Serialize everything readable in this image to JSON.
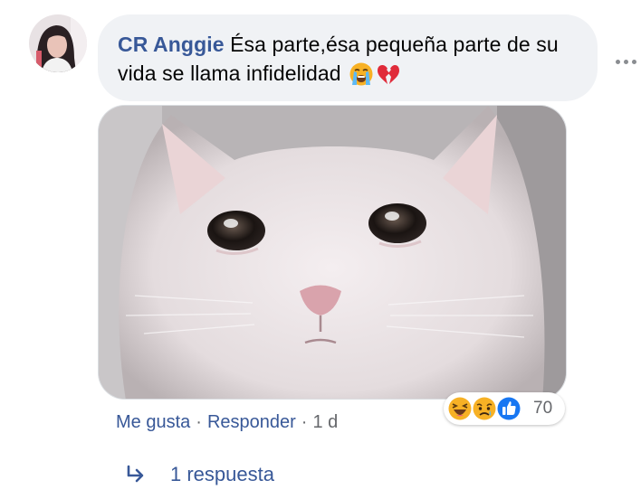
{
  "comment": {
    "author": "CR Anggie",
    "text": "Ésa parte,ésa pequeña parte de su vida se llama infidelidad",
    "emojis": [
      "loudly-crying-face",
      "broken-heart"
    ],
    "avatar": "profile-photo"
  },
  "photo": {
    "subject": "crying-white-cat"
  },
  "actions": {
    "like": "Me gusta",
    "separator": "·",
    "reply": "Responder",
    "age": "1 d"
  },
  "reactions": {
    "types": [
      "haha",
      "sad",
      "like"
    ],
    "count": "70"
  },
  "replies": {
    "label": "1 respuesta",
    "icon": "reply-arrow-icon"
  },
  "colors": {
    "link": "#385898",
    "muted": "#65676b",
    "bubble": "#f0f2f5",
    "like_blue": "#1877f2",
    "emoji_yellow": "#f7b125"
  }
}
